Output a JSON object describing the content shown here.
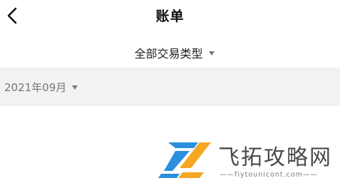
{
  "header": {
    "title": "账单"
  },
  "filter": {
    "type_label": "全部交易类型"
  },
  "month_bar": {
    "month": "2021年09月"
  },
  "watermark": {
    "site_name": "飞拓攻略网",
    "url": "——fiytounicont.com——"
  },
  "icons": {
    "back": "chevron-left-icon",
    "dropdown": "caret-down-icon"
  },
  "colors": {
    "month_bar_bg": "#f2f2f2",
    "logo_blue": "#2a8fdd",
    "logo_orange": "#f5a623"
  }
}
